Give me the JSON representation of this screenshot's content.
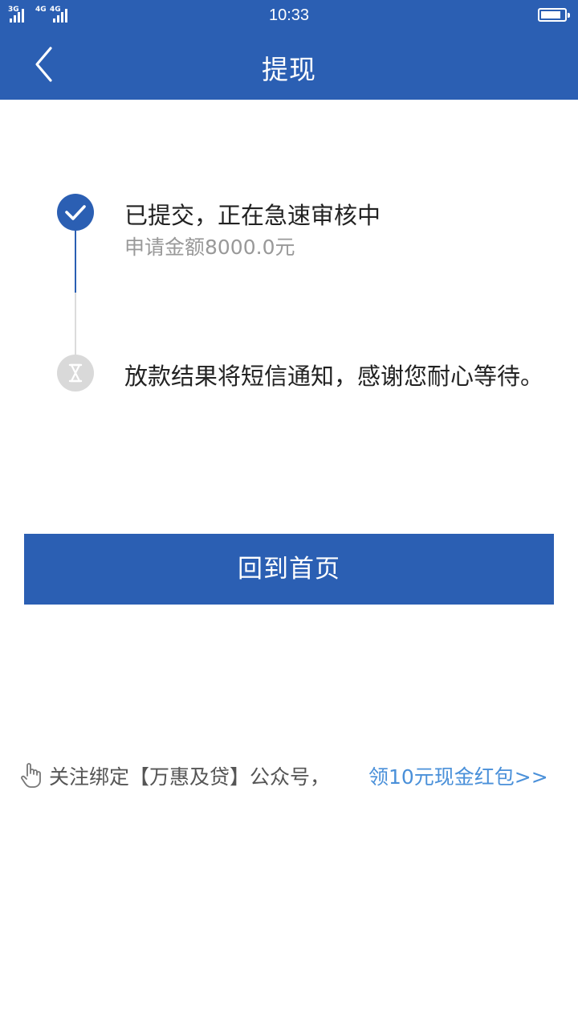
{
  "status_bar": {
    "signal1_label": "3G",
    "signal2_label": "4G",
    "signal2_label_b": "4G",
    "time": "10:33"
  },
  "nav": {
    "title": "提现"
  },
  "steps": [
    {
      "title": "已提交，正在急速审核中",
      "subtitle": "申请金额8000.0元",
      "state": "done"
    },
    {
      "title": "放款结果将短信通知，感谢您耐心等待。",
      "state": "pending"
    }
  ],
  "home_button": {
    "label": "回到首页"
  },
  "promo": {
    "text": "关注绑定【万惠及贷】公众号，",
    "link": "领10元现金红包>>"
  },
  "colors": {
    "primary": "#2b5fb3",
    "link": "#4a90d9",
    "pending": "#d9d9d9"
  }
}
